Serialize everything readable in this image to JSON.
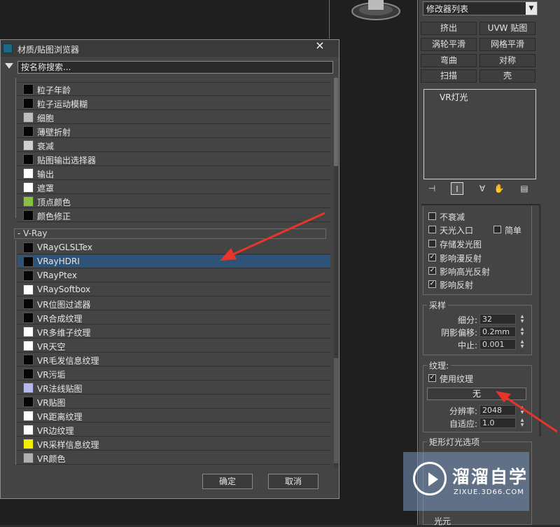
{
  "dialog": {
    "title": "材质/贴图浏览器",
    "close_icon": "×",
    "search_placeholder": "按名称搜索...",
    "items_before": [
      {
        "label": "粒子年龄",
        "color": "#050505"
      },
      {
        "label": "粒子运动模糊",
        "color": "#050505"
      },
      {
        "label": "细胞",
        "color": "#bdbdbd"
      },
      {
        "label": "薄壁折射",
        "color": "#050505"
      },
      {
        "label": "衰减",
        "color": "#d0d0d0"
      },
      {
        "label": "贴图输出选择器",
        "color": "#050505"
      },
      {
        "label": "输出",
        "color": "#ffffff"
      },
      {
        "label": "遮罩",
        "color": "#ffffff"
      },
      {
        "label": "顶点颜色",
        "color": "#88c040"
      },
      {
        "label": "颜色修正",
        "color": "#050505"
      }
    ],
    "group_label": "- V-Ray",
    "vray_items": [
      {
        "label": "VRayGLSLTex",
        "color": "#050505"
      },
      {
        "label": "VRayHDRI",
        "color": "#050505",
        "selected": true
      },
      {
        "label": "VRayPtex",
        "color": "#050505"
      },
      {
        "label": "VRaySoftbox",
        "color": "#ffffff"
      },
      {
        "label": "VR位图过滤器",
        "color": "#050505"
      },
      {
        "label": "VR合成纹理",
        "color": "#050505"
      },
      {
        "label": "VR多维子纹理",
        "color": "#ffffff"
      },
      {
        "label": "VR天空",
        "color": "#ffffff"
      },
      {
        "label": "VR毛发信息纹理",
        "color": "#050505"
      },
      {
        "label": "VR污垢",
        "color": "#050505"
      },
      {
        "label": "VR法线贴图",
        "color": "#b8b8f0"
      },
      {
        "label": "VR贴图",
        "color": "#050505"
      },
      {
        "label": "VR距离纹理",
        "color": "#ffffff"
      },
      {
        "label": "VR边纹理",
        "color": "#ffffff"
      },
      {
        "label": "VR采样信息纹理",
        "color": "#f0f000"
      },
      {
        "label": "VR颜色",
        "color": "#b0b0b0"
      }
    ],
    "ok_label": "确定",
    "cancel_label": "取消"
  },
  "panel": {
    "modifier_list": "修改器列表",
    "modifier_buttons": [
      "挤出",
      "UVW 贴图",
      "涡轮平滑",
      "网格平滑",
      "弯曲",
      "对称",
      "扫描",
      "壳"
    ],
    "stack_item": "VR灯光",
    "options": [
      {
        "label": "不衰减",
        "checked": false
      },
      {
        "label": "天光入口",
        "checked": false
      },
      {
        "label": "简单",
        "checked": false
      },
      {
        "label": "存储发光图",
        "checked": false
      },
      {
        "label": "影响漫反射",
        "checked": true
      },
      {
        "label": "影响高光反射",
        "checked": true
      },
      {
        "label": "影响反射",
        "checked": true
      }
    ],
    "sampling": {
      "title": "采样",
      "subdivs_label": "细分:",
      "subdivs_value": "32",
      "shadow_bias_label": "阴影偏移:",
      "shadow_bias_value": "0.2mm",
      "cutoff_label": "中止:",
      "cutoff_value": "0.001"
    },
    "texture": {
      "title": "纹理:",
      "use_texture_label": "使用纹理",
      "use_texture_checked": true,
      "none_button": "无",
      "resolution_label": "分辨率:",
      "resolution_value": "2048",
      "adaptive_label": "自适应:",
      "adaptive_value": "1.0"
    },
    "rect_light_title": "矩形灯光选项",
    "bottom_partial": "光元"
  },
  "watermark": {
    "text": "溜溜自学",
    "url": "ZIXUE.3D66.COM"
  }
}
